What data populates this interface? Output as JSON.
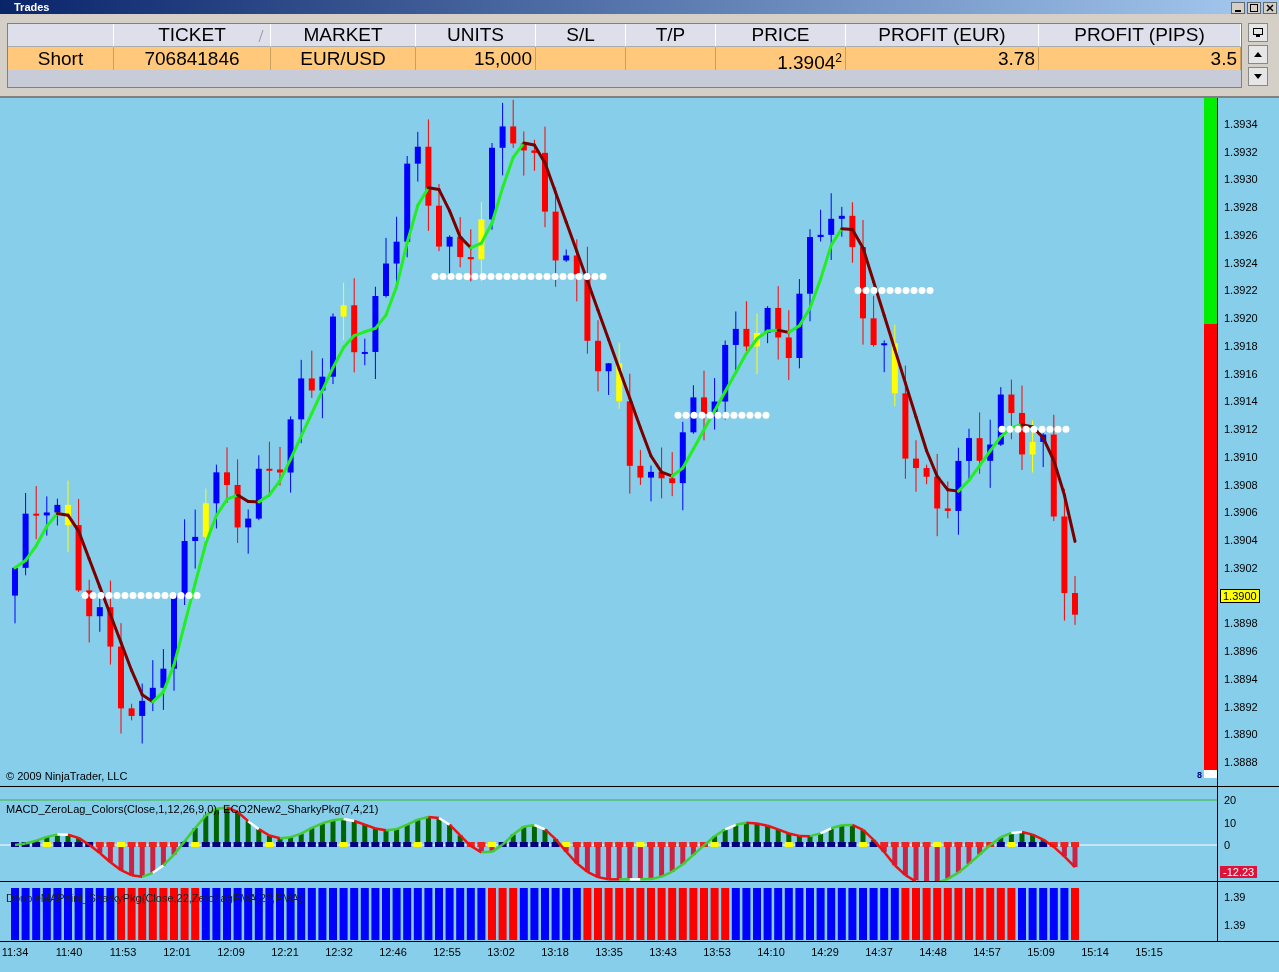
{
  "window": {
    "title": "Trades"
  },
  "table": {
    "columns": [
      "",
      "TICKET",
      "MARKET",
      "UNITS",
      "S/L",
      "T/P",
      "PRICE",
      "PROFIT (EUR)",
      "PROFIT (PIPS)"
    ],
    "rows": [
      {
        "cells": [
          "Short",
          "706841846",
          "EUR/USD",
          "15,000",
          "",
          "",
          "1.3904$^{2}$",
          "3.78",
          "3.5"
        ]
      }
    ]
  },
  "chart": {
    "copyright": "© 2009 NinjaTrader, LLC",
    "price_axis": {
      "ticks": [
        "1.3934",
        "1.3932",
        "1.3930",
        "1.3928",
        "1.3926",
        "1.3924",
        "1.3922",
        "1.3920",
        "1.3918",
        "1.3916",
        "1.3914",
        "1.3912",
        "1.3910",
        "1.3908",
        "1.3906",
        "1.3904",
        "1.3902",
        "1.3898",
        "1.3896",
        "1.3894",
        "1.3892",
        "1.3890",
        "1.3888"
      ],
      "current_price": "1.3900",
      "bar_count": "8"
    },
    "indicators": [
      {
        "label": "MACD_ZeroLag_Colors(Close,1,12,26,9,0), ECO2New2_SharkyPkg(7,4,21)",
        "axis_ticks": [
          "20",
          "10",
          "0"
        ],
        "value_label": "-12.23"
      },
      {
        "label": "DoubleMAPaint_SharkyPkg(Close,22,ZeroLagEMA,22,EMA)",
        "axis_ticks": [
          "1.39",
          "1.39"
        ]
      }
    ],
    "time_axis": {
      "labels": [
        "11:34",
        "11:40",
        "11:53",
        "12:01",
        "12:09",
        "12:21",
        "12:32",
        "12:46",
        "12:55",
        "13:02",
        "13:18",
        "13:35",
        "13:43",
        "13:53",
        "14:10",
        "14:29",
        "14:37",
        "14:48",
        "14:57",
        "15:09",
        "15:14",
        "15:15"
      ]
    }
  }
}
